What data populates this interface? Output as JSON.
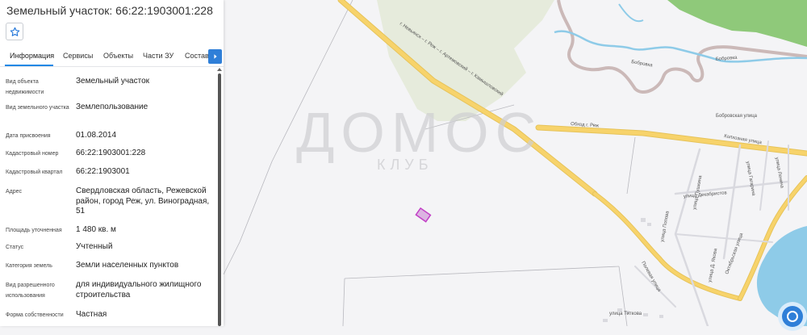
{
  "panel": {
    "title": "Земельный участок: 66:22:1903001:228",
    "tabs": [
      {
        "label": "Информация",
        "active": true
      },
      {
        "label": "Сервисы",
        "active": false
      },
      {
        "label": "Объекты",
        "active": false
      },
      {
        "label": "Части ЗУ",
        "active": false
      },
      {
        "label": "Состав",
        "active": false
      }
    ],
    "properties": [
      {
        "label": "Вид объекта недвижимости",
        "value": "Земельный участок"
      },
      {
        "label": "Вид земельного участка",
        "value": "Землепользование"
      },
      {
        "label": "Дата присвоения",
        "value": "01.08.2014"
      },
      {
        "label": "Кадастровый номер",
        "value": "66:22:1903001:228"
      },
      {
        "label": "Кадастровый квартал",
        "value": "66:22:1903001"
      },
      {
        "label": "Адрес",
        "value": "Свердловская область, Режевской район, город Реж, ул. Виноградная, 51"
      },
      {
        "label": "Площадь уточненная",
        "value": "1 480 кв. м"
      },
      {
        "label": "Статус",
        "value": "Учтенный"
      },
      {
        "label": "Категория земель",
        "value": "Земли населенных пунктов"
      },
      {
        "label": "Вид разрешенного использования",
        "value": "для индивидуального жилищного строительства"
      },
      {
        "label": "Форма собственности",
        "value": "Частная"
      }
    ]
  },
  "map": {
    "watermark_main": "ДОМОС",
    "watermark_sub": "КЛУБ",
    "road_labels": {
      "highway": "г. Невьянск – г. Реж – г. Артемовский – г. Камышловский",
      "bypass": "Обход г. Реж",
      "kolkhoznaya": "Колхозная улица",
      "bobrovskaya_st": "Бобровская улица",
      "bobrovka": "Бобровка",
      "bobrovka2": "Бобровка",
      "dekabristov": "улица Декабристов",
      "polevaya": "Полевая улица",
      "oktyabrskaya": "Октябрьская улица",
      "gagarina": "улица Гагарина",
      "lenina": "улица Ленина",
      "pushkina": "улица Пушкина",
      "tetkina": "улица Титкова",
      "popova": "улица Попова",
      "dmitrova": "улица Д. Якова"
    },
    "colors": {
      "forest": "#8fc97a",
      "field": "#e6ebdc",
      "road": "#f7d36b",
      "water": "#8ecbe8",
      "plot": "#c23fc6"
    }
  },
  "icons": {
    "favorite": "star-icon",
    "tab_next": "chevron-right-icon",
    "locate": "locate-icon"
  }
}
